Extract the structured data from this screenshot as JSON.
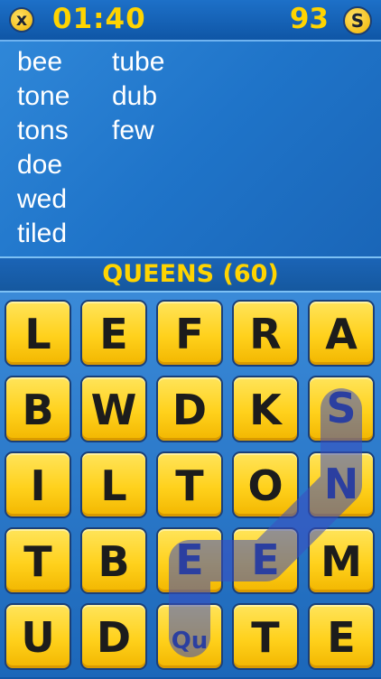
{
  "header": {
    "close_label": "x",
    "timer": "01:40",
    "score": "93",
    "coin_label": "S"
  },
  "found_words": {
    "column1": [
      "bee",
      "tone",
      "tons",
      "doe",
      "wed",
      "tiled"
    ],
    "column2": [
      "tube",
      "dub",
      "few"
    ]
  },
  "current_word": "QUEENS (60)",
  "board": {
    "rows": [
      [
        "L",
        "E",
        "F",
        "R",
        "A"
      ],
      [
        "B",
        "W",
        "D",
        "K",
        "S"
      ],
      [
        "I",
        "L",
        "T",
        "O",
        "N"
      ],
      [
        "T",
        "B",
        "E",
        "E",
        "M"
      ],
      [
        "U",
        "D",
        "Qu",
        "T",
        "E"
      ]
    ],
    "selected_path": [
      [
        4,
        2
      ],
      [
        3,
        2
      ],
      [
        3,
        3
      ],
      [
        2,
        4
      ],
      [
        1,
        4
      ]
    ],
    "colors": {
      "tile": "#ffd11c",
      "path": "#3b4cc0",
      "text_yellow": "#ffd400"
    }
  }
}
